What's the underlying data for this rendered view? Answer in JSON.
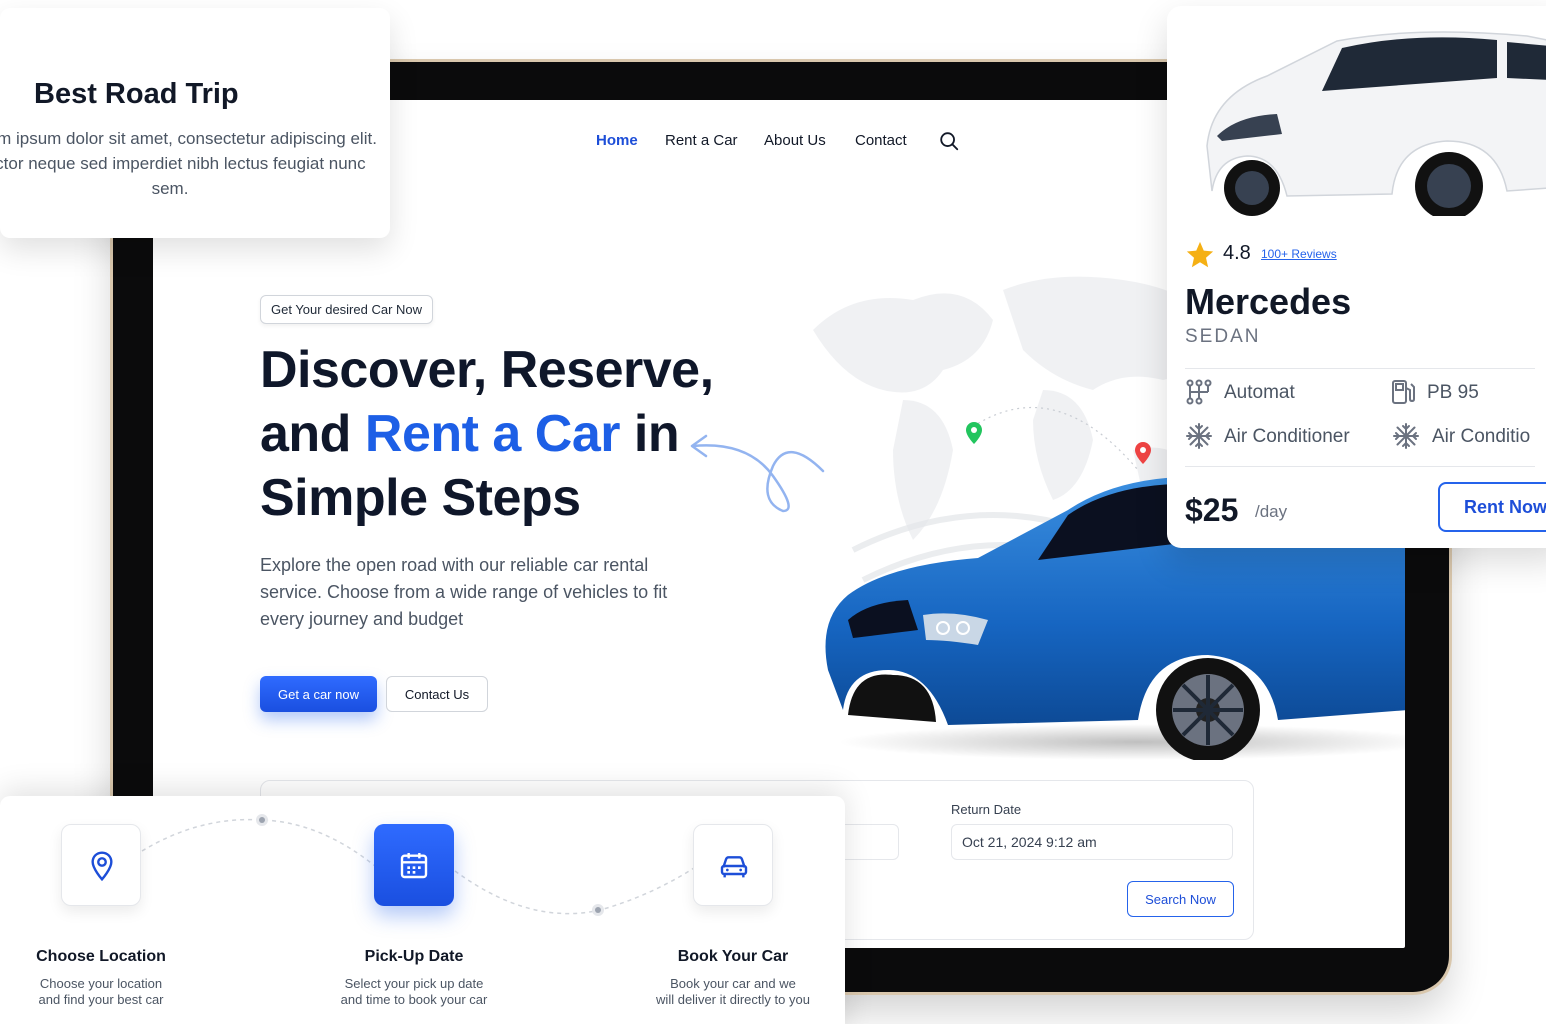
{
  "nav": {
    "items": [
      {
        "label": "Home",
        "active": true
      },
      {
        "label": "Rent a Car",
        "active": false
      },
      {
        "label": "About Us",
        "active": false
      },
      {
        "label": "Contact",
        "active": false
      }
    ],
    "search_icon": "search-icon"
  },
  "hero": {
    "tag": "Get Your desired Car Now",
    "title_line1": "Discover, Reserve,",
    "title_and": "and ",
    "title_accent": "Rent a Car",
    "title_in": " in",
    "title_line3": "Simple Steps",
    "description": "Explore the open road with our reliable car rental service. Choose from a wide range of vehicles to fit every journey and budget",
    "primary_button": "Get a car now",
    "secondary_button": "Contact Us"
  },
  "search": {
    "return_label": "Return Date",
    "return_value": "Oct 21, 2024 9:12 am",
    "button": "Search Now"
  },
  "trip_card": {
    "title": "Best Road Trip",
    "text": "Lorem ipsum dolor sit amet, consectetur adipiscing elit. Auctor neque sed imperdiet nibh lectus feugiat nunc sem."
  },
  "car_card": {
    "rating": "4.8",
    "reviews": "100+ Reviews",
    "name": "Mercedes",
    "type": "SEDAN",
    "specs": [
      "Automat",
      "PB 95",
      "Air Conditioner",
      "Air Conditio"
    ],
    "price": "$25",
    "unit": "/day",
    "button": "Rent Now"
  },
  "steps": [
    {
      "icon": "location-pin-icon",
      "title": "Choose Location",
      "line1": "Choose your location",
      "line2": "and find your best car",
      "active": false
    },
    {
      "icon": "calendar-icon",
      "title": "Pick-Up Date",
      "line1": "Select your pick up date",
      "line2": "and time to book your car",
      "active": true
    },
    {
      "icon": "car-icon",
      "title": "Book Your Car",
      "line1": "Book your car and we",
      "line2": "will deliver it directly to you",
      "active": false
    }
  ],
  "colors": {
    "accent": "#1d5fe6",
    "primary_button": "#2563eb",
    "star": "#f5b014"
  }
}
